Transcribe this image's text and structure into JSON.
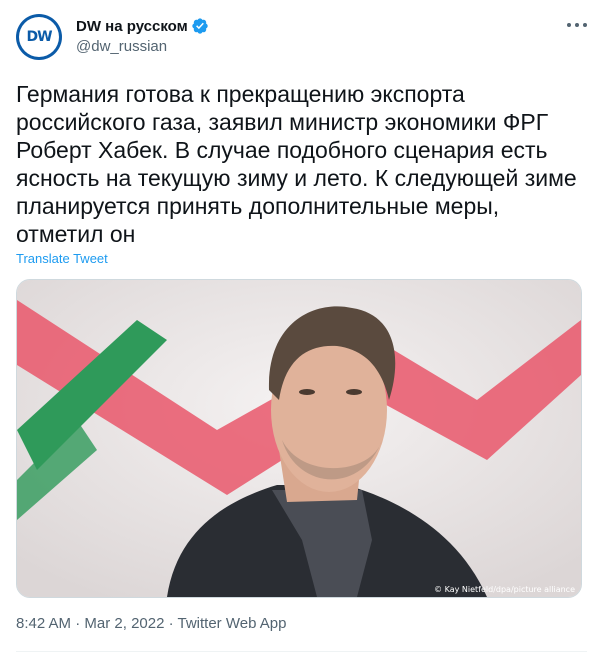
{
  "account": {
    "display_name": "DW на русском",
    "handle": "@dw_russian",
    "avatar_text": "DW",
    "verified": true
  },
  "tweet": {
    "text": "Германия готова к прекращению экспорта российского газа, заявил министр экономики ФРГ Роберт Хабек. В случае подобного сценария есть ясность на текущую зиму и лето. К следующей зиме планируется принять дополнительные меры, отметил он",
    "translate_label": "Translate Tweet",
    "image_credit": "© Kay Nietfeld/dpa/picture alliance",
    "time": "8:42 AM",
    "separator": " · ",
    "date": "Mar 2, 2022",
    "source": "Twitter Web App"
  },
  "colors": {
    "accent": "#1d9bf0",
    "dw_blue": "#0b5ba8",
    "text": "#0f1419",
    "secondary": "#536471"
  },
  "icons": [
    "dw-logo",
    "verified-badge-icon",
    "more-options-icon"
  ]
}
